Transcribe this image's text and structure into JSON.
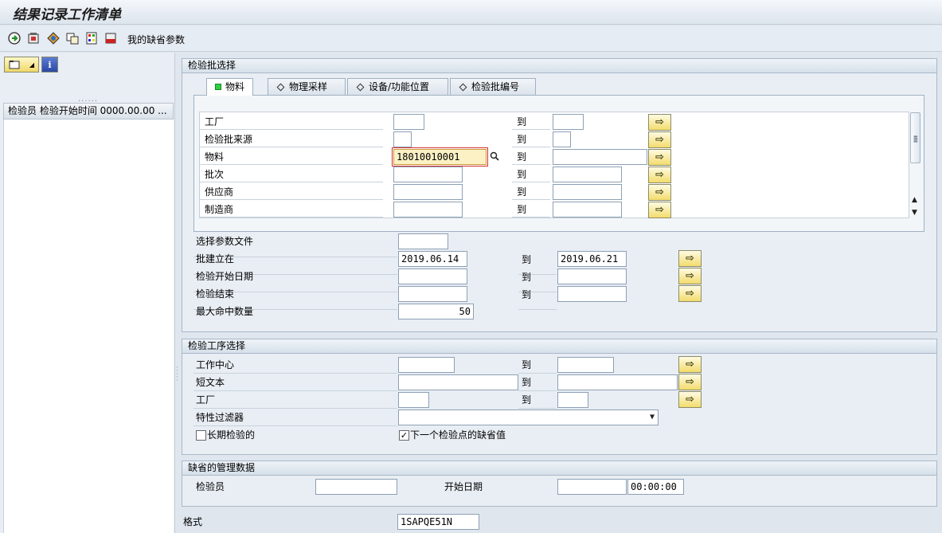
{
  "window": {
    "title": "结果记录工作清单"
  },
  "toolbar": {
    "variant_label": "我的缺省参数"
  },
  "left_panel": {
    "column_header": "检验员 检验开始时间 0000.00.00 ...",
    "info_icon_text": "i"
  },
  "lot_selection": {
    "title": "检验批选择",
    "tabs": [
      {
        "label": "物料",
        "active": true
      },
      {
        "label": "物理采样",
        "active": false
      },
      {
        "label": "设备/功能位置",
        "active": false
      },
      {
        "label": "检验批编号",
        "active": false
      }
    ],
    "to_label": "到",
    "rows": [
      {
        "label": "工厂",
        "from": "",
        "to": ""
      },
      {
        "label": "检验批来源",
        "from": "",
        "to": ""
      },
      {
        "label": "物料",
        "from": "18010010001",
        "to": ""
      },
      {
        "label": "批次",
        "from": "",
        "to": ""
      },
      {
        "label": "供应商",
        "from": "",
        "to": ""
      },
      {
        "label": "制造商",
        "from": "",
        "to": ""
      }
    ],
    "extra_rows": [
      {
        "label": "选择参数文件",
        "from": ""
      },
      {
        "label": "批建立在",
        "from": "2019.06.14",
        "to": "2019.06.21"
      },
      {
        "label": "检验开始日期",
        "from": "",
        "to": ""
      },
      {
        "label": "检验结束",
        "from": "",
        "to": ""
      },
      {
        "label": "最大命中数量",
        "from": "50"
      }
    ]
  },
  "op_selection": {
    "title": "检验工序选择",
    "rows": [
      {
        "label": "工作中心",
        "from": "",
        "to": ""
      },
      {
        "label": "短文本",
        "from": "",
        "to": ""
      },
      {
        "label": "工厂",
        "from": "",
        "to": ""
      }
    ],
    "filter_label": "特性过滤器",
    "filter_value": "",
    "long_term_label": "长期检验的",
    "long_term_checked": false,
    "default_next_label": "下一个检验点的缺省值",
    "default_next_checked": true
  },
  "admin": {
    "title": "缺省的管理数据",
    "inspector_label": "检验员",
    "inspector_value": "",
    "start_date_label": "开始日期",
    "start_date_value": "",
    "start_time_value": "00:00:00"
  },
  "layout_field": {
    "label": "格式",
    "value": "1SAPQE51N"
  },
  "colors": {
    "accent": "#f3dc6c",
    "frame": "#a9b8c8",
    "background": "#dfe6ee"
  }
}
